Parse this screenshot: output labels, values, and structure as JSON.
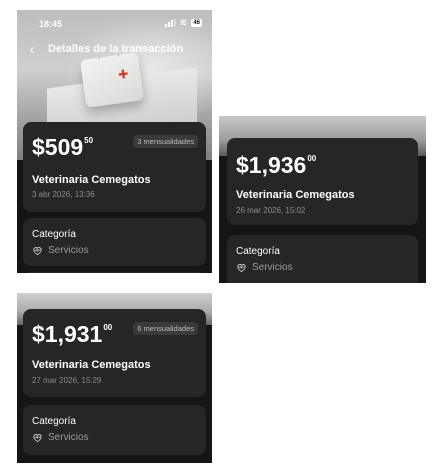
{
  "screens": [
    {
      "status_time": "18:45",
      "battery": "46",
      "nav_title": "Detalles de la transacción",
      "amount_int": "$509",
      "amount_dec": "50",
      "installments": "3 mensualidades",
      "merchant": "Veterinaria Cemegatos",
      "date": "3 abr 2026, 13:36",
      "category_label": "Categoría",
      "category_value": "Servicios"
    },
    {
      "amount_int": "$1,936",
      "amount_dec": "00",
      "merchant": "Veterinaria Cemegatos",
      "date": "26 mar 2026, 15:02",
      "category_label": "Categoría",
      "category_value": "Servicios"
    },
    {
      "amount_int": "$1,931",
      "amount_dec": "00",
      "installments": "6 mensualidades",
      "merchant": "Veterinaria Cemegatos",
      "date": "27 mar 2026, 15:29",
      "category_label": "Categoría",
      "category_value": "Servicios"
    }
  ],
  "icons": {
    "back": "chevron-left-icon",
    "category": "heart-pulse-icon"
  },
  "colors": {
    "background": "#151515",
    "card": "#262626",
    "badge": "#3a3a3a",
    "muted_text": "#8c8c8c"
  }
}
